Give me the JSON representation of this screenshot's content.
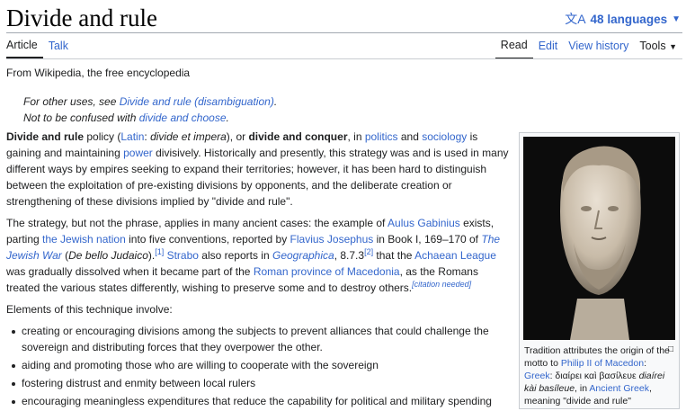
{
  "header": {
    "title": "Divide and rule",
    "languages": "48 languages"
  },
  "tabs": {
    "article": "Article",
    "talk": "Talk",
    "read": "Read",
    "edit": "Edit",
    "history": "View history",
    "tools": "Tools"
  },
  "tagline": "From Wikipedia, the free encyclopedia",
  "hatnote": {
    "pre1": "For other uses, see ",
    "link1": "Divide and rule (disambiguation)",
    "post1": ".",
    "pre2": "Not to be confused with ",
    "link2": "divide and choose",
    "post2": "."
  },
  "p1": {
    "b1": "Divide and rule",
    "t1": " policy (",
    "latin": "Latin",
    "t2": ": ",
    "latin_phrase": "divide et impera",
    "t3": "), or ",
    "b2": "divide and conquer",
    "t4": ", in ",
    "politics": "politics",
    "t5": " and ",
    "sociology": "sociology",
    "t6": " is gaining and maintaining ",
    "power": "power",
    "t7": " divisively. Historically and presently, this strategy was and is used in many different ways by empires seeking to expand their territories; however, it has been hard to distinguish between the exploitation of pre-existing divisions by opponents, and the deliberate creation or strengthening of these divisions implied by \"divide and rule\"."
  },
  "p2": {
    "t1": "The strategy, but not the phrase, applies in many ancient cases: the example of ",
    "gabinius": "Aulus Gabinius",
    "t2": " exists, parting ",
    "jewish_nation": "the Jewish nation",
    "t3": " into five conventions, reported by ",
    "josephus": "Flavius Josephus",
    "t4": " in Book I, 169–170 of ",
    "jewish_war": "The Jewish War",
    "t5": " (",
    "latin_title": "De bello Judaico",
    "t6": ").",
    "ref1": "[1]",
    "t7": " ",
    "strabo": "Strabo",
    "t8": " also reports in ",
    "geographica": "Geographica",
    "t9": ", 8.7.3",
    "ref2": "[2]",
    "t10": " that the ",
    "achaean": "Achaean League",
    "t11": " was gradually dissolved when it became part of the ",
    "macedonia": "Roman province of Macedonia",
    "t12": ", as the Romans treated the various states differently, wishing to preserve some and to destroy others.",
    "cn": "[citation needed]"
  },
  "p3": "Elements of this technique involve:",
  "list": [
    "creating or encouraging divisions among the subjects to prevent alliances that could challenge the sovereign and distributing forces that they overpower the other.",
    "aiding and promoting those who are willing to cooperate with the sovereign",
    "fostering distrust and enmity between local rulers",
    "encouraging meaningless expenditures that reduce the capability for political and military spending"
  ],
  "infobox": {
    "c1": "Tradition attributes the origin of the motto to ",
    "philip": "Philip II of Macedon",
    "c2": ": ",
    "greek": "Greek",
    "c3": ": διαίρει καὶ βασίλευε ",
    "translit": "diaírei kài basíleue",
    "c4": ", in ",
    "ancient_greek": "Ancient Greek",
    "c5": ", meaning \"divide and rule\""
  },
  "colors": {
    "link": "#3366cc",
    "text": "#202122",
    "border": "#a2a9b1"
  },
  "icons": [
    "translate-icon",
    "chevron-down-icon",
    "magnify-icon"
  ]
}
